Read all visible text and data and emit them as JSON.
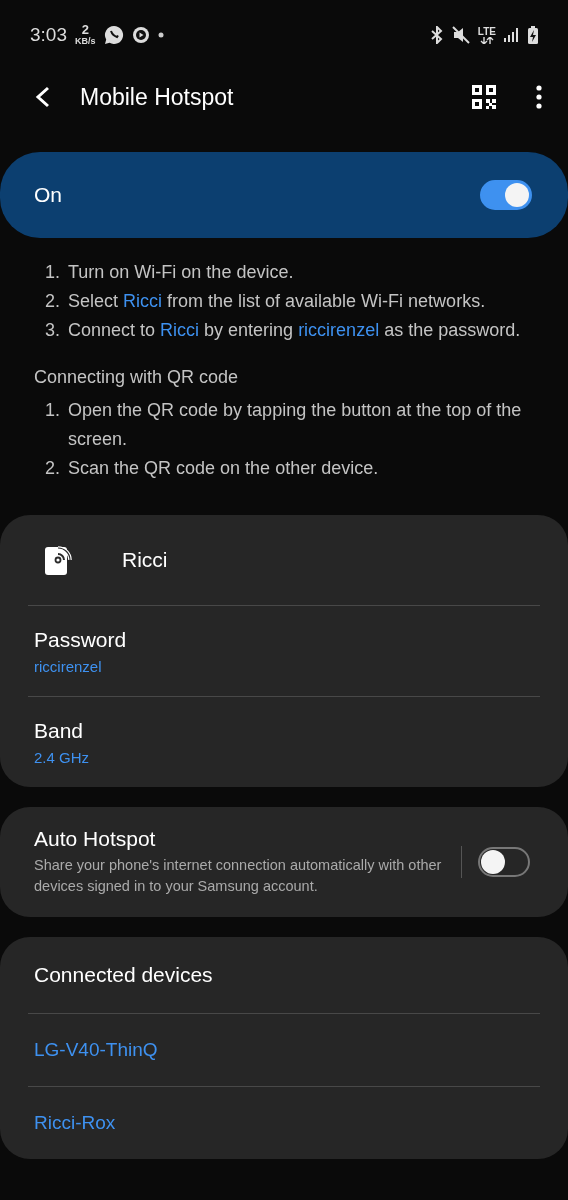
{
  "status_bar": {
    "time": "3:03",
    "speed_value": "2",
    "speed_unit": "KB/s",
    "network": "LTE"
  },
  "header": {
    "title": "Mobile Hotspot"
  },
  "master_switch": {
    "label": "On",
    "on": true
  },
  "instructions": {
    "steps": [
      {
        "number": "1.",
        "parts": [
          {
            "text": "Turn on Wi-Fi on the device.",
            "highlight": false
          }
        ]
      },
      {
        "number": "2.",
        "parts": [
          {
            "text": "Select ",
            "highlight": false
          },
          {
            "text": "Ricci",
            "highlight": true
          },
          {
            "text": " from the list of available Wi-Fi networks.",
            "highlight": false
          }
        ]
      },
      {
        "number": "3.",
        "parts": [
          {
            "text": "Connect to ",
            "highlight": false
          },
          {
            "text": "Ricci",
            "highlight": true
          },
          {
            "text": " by entering ",
            "highlight": false
          },
          {
            "text": "riccirenzel",
            "highlight": true
          },
          {
            "text": " as the password.",
            "highlight": false
          }
        ]
      }
    ],
    "qr_heading": "Connecting with QR code",
    "qr_steps": [
      {
        "number": "1.",
        "parts": [
          {
            "text": "Open the QR code by tapping the button at the top of the screen.",
            "highlight": false
          }
        ]
      },
      {
        "number": "2.",
        "parts": [
          {
            "text": "Scan the QR code on the other device.",
            "highlight": false
          }
        ]
      }
    ]
  },
  "network": {
    "name": "Ricci",
    "settings": [
      {
        "label": "Password",
        "value": "riccirenzel"
      },
      {
        "label": "Band",
        "value": "2.4 GHz"
      }
    ]
  },
  "auto_hotspot": {
    "title": "Auto Hotspot",
    "description": "Share your phone's internet connection automatically with other devices signed in to your Samsung account.",
    "on": false
  },
  "connected_devices": {
    "title": "Connected devices",
    "devices": [
      "LG-V40-ThinQ",
      "Ricci-Rox"
    ]
  }
}
